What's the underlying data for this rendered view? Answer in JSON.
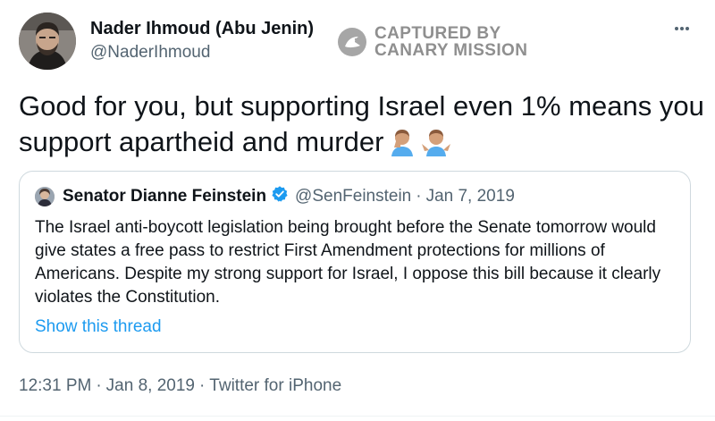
{
  "tweet": {
    "author": {
      "name": "Nader Ihmoud (Abu Jenin)",
      "handle": "@NaderIhmoud"
    },
    "text": "Good for you, but supporting Israel even 1% means you support apartheid and murder",
    "emojis": [
      "man-facepalming-emoji",
      "man-shrugging-emoji"
    ],
    "timestamp": {
      "time": "12:31 PM",
      "date": "Jan 8, 2019",
      "source": "Twitter for iPhone"
    }
  },
  "watermark": {
    "line1": "CAPTURED BY",
    "line2": "CANARY MISSION"
  },
  "quoted_tweet": {
    "author_name": "Senator Dianne Feinstein",
    "verified": true,
    "handle": "@SenFeinstein",
    "separator": "·",
    "date": "Jan 7, 2019",
    "text": "The Israel anti-boycott legislation being brought before the Senate tomorrow would give states a free pass to restrict First Amendment protections for millions of Americans. Despite my strong support for Israel, I oppose this bill because it clearly violates the Constitution.",
    "show_thread_label": "Show this thread"
  },
  "meta_separator": "·",
  "colors": {
    "text_primary": "#0f1419",
    "text_secondary": "#536471",
    "link": "#1d9bf0",
    "verified": "#1d9bf0",
    "border": "#cfd9de",
    "watermark": "#8f8f8f"
  },
  "icons": {
    "more": "more-horizontal-icon",
    "verified": "verified-badge-icon",
    "watermark": "canary-mission-logo-icon"
  }
}
